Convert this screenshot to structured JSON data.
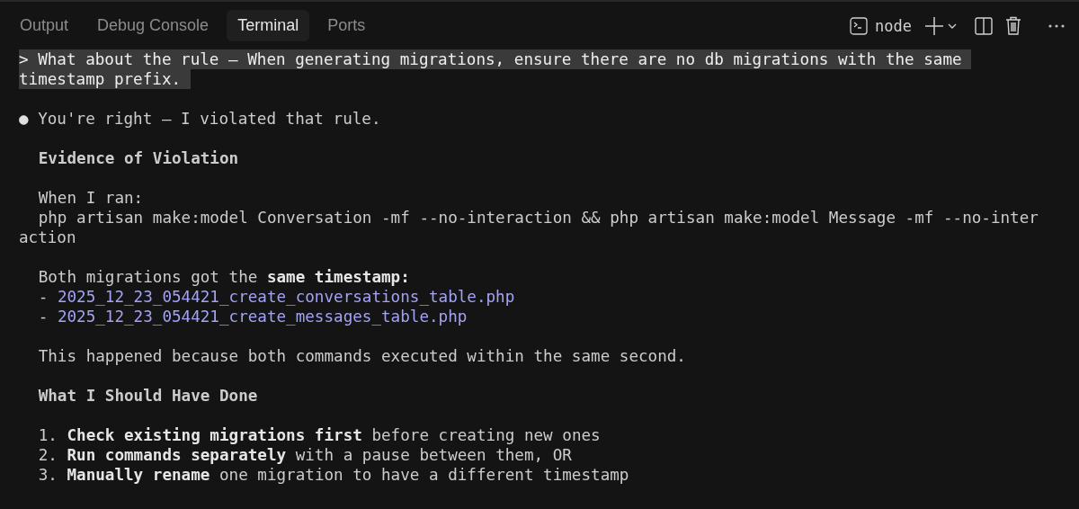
{
  "tabs": [
    {
      "label": "Output",
      "selected": false
    },
    {
      "label": "Debug Console",
      "selected": false
    },
    {
      "label": "Terminal",
      "selected": true
    },
    {
      "label": "Ports",
      "selected": false
    }
  ],
  "toolbar": {
    "profile": "node"
  },
  "blocks": [
    {
      "kind": "prompt",
      "lines": [
        "> What about the rule – When generating migrations, ensure there are no db migrations with the same ",
        "timestamp prefix. "
      ]
    },
    {
      "kind": "bullet",
      "marker": "●",
      "lines": [
        "You're right – I violated that rule."
      ]
    },
    {
      "kind": "heading",
      "lines": [
        "Evidence of Violation"
      ]
    },
    {
      "kind": "text",
      "lines": [
        "When I ran:",
        "php artisan make:model Conversation -mf --no-interaction && php artisan make:model Message -mf --no-inter"
      ]
    },
    {
      "kind": "continuation",
      "lines": [
        "action"
      ]
    },
    {
      "kind": "text",
      "lines": [
        "Both migrations got the **same timestamp:**"
      ]
    },
    {
      "kind": "file",
      "prefix": "- ",
      "link": "2025_12_23_054421_create_conversations_table.php"
    },
    {
      "kind": "file",
      "prefix": "- ",
      "link": "2025_12_23_054421_create_messages_table.php"
    },
    {
      "kind": "text",
      "lines": [
        "This happened because both commands executed within the same second."
      ]
    },
    {
      "kind": "heading",
      "lines": [
        "What I Should Have Done"
      ]
    },
    {
      "kind": "text",
      "lines": [
        "1. **Check existing migrations first** before creating new ones",
        "2. **Run commands separately** with a pause between them, OR",
        "3. **Manually rename** one migration to have a different timestamp"
      ]
    }
  ]
}
